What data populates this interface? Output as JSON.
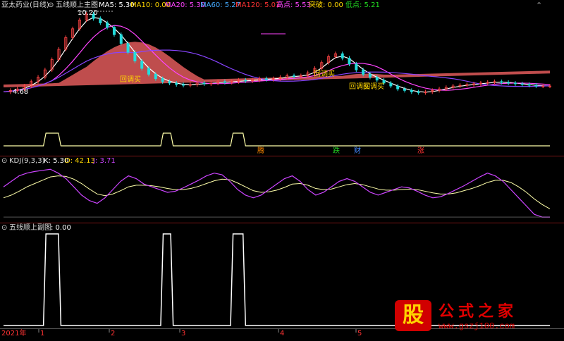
{
  "main_panel": {
    "stock": "亚太药业(日线)",
    "indicator": "五线顺上主图",
    "ma": [
      {
        "label": "MA5: 5.30",
        "color": "#ffffff"
      },
      {
        "label": "MA10: 0.00",
        "color": "#ffd700"
      },
      {
        "label": "MA20: 5.30",
        "color": "#ff44ff"
      },
      {
        "label": "MA60: 5.27",
        "color": "#44aaff"
      },
      {
        "label": "MA120: 5.01",
        "color": "#ff3333"
      }
    ],
    "high_point": "高点: 5.53",
    "breakout": "突破: 0.00",
    "low_point": "低点: 5.21",
    "price_max": "10.20",
    "price_min": "4.68",
    "signals": [
      {
        "text": "回调买"
      },
      {
        "text": "回调买"
      },
      {
        "text": "回调买"
      },
      {
        "text": "回调买"
      }
    ],
    "markers": [
      {
        "text": "腾",
        "color": "#ff8800"
      },
      {
        "text": "跌",
        "color": "#22cc22"
      },
      {
        "text": "财",
        "color": "#4488ff"
      },
      {
        "text": "涨",
        "color": "#ff3333"
      }
    ]
  },
  "kdj_panel": {
    "title": "KDJ(9,3,3)",
    "k": "K: 5.30",
    "d": "D: 42.13",
    "j": "J: 3.71"
  },
  "sub_panel": {
    "title": "五线顺上副图",
    "value": ": 0.00"
  },
  "time_axis": {
    "year": "2021年",
    "months": [
      "1",
      "2",
      "3",
      "4",
      "5"
    ]
  },
  "watermark": {
    "badge": "股",
    "title": "公式之家",
    "url": "www.gszj100.com"
  },
  "chart_data": {
    "type": "line",
    "title": "",
    "price_range": [
      4.68,
      10.2
    ],
    "kdj_range": [
      0,
      100
    ],
    "sub_range": [
      0,
      1
    ],
    "sub_signal": [
      0,
      0,
      0,
      0,
      0,
      0,
      0,
      0,
      0,
      0,
      0,
      0,
      0,
      0,
      0,
      0,
      0,
      1,
      1,
      1,
      1,
      1,
      1,
      0,
      0,
      0,
      0,
      0,
      0,
      0,
      0,
      0,
      0,
      0,
      0,
      0,
      0,
      0,
      0,
      0,
      0,
      0,
      0,
      0,
      0,
      0,
      0,
      0,
      0,
      0,
      0,
      0,
      0,
      0,
      0,
      0,
      0,
      0,
      0,
      0,
      0,
      0,
      0,
      0,
      1,
      1,
      1,
      1,
      0,
      0,
      0,
      0,
      0,
      0,
      0,
      0,
      0,
      0,
      0,
      0,
      0,
      0,
      0,
      0,
      0,
      0,
      0,
      0,
      0,
      0,
      0,
      0,
      1,
      1,
      1,
      1,
      1,
      0,
      0,
      0,
      0,
      0,
      0,
      0,
      0,
      0,
      0,
      0,
      0,
      0,
      0,
      0,
      0,
      0,
      0,
      0,
      0,
      0,
      0,
      0,
      0,
      0,
      0,
      0,
      0,
      0,
      0,
      0,
      0,
      0,
      0,
      0,
      0,
      0,
      0,
      0,
      0,
      0,
      0,
      0,
      0,
      0,
      0,
      0,
      0,
      0,
      0,
      0,
      0,
      0,
      0,
      0,
      0,
      0,
      0,
      0,
      0,
      0,
      0,
      0,
      0,
      0,
      0,
      0,
      0,
      0,
      0,
      0,
      0,
      0,
      0,
      0,
      0,
      0,
      0,
      0,
      0,
      0,
      0,
      0,
      0,
      0,
      0,
      0,
      0,
      0,
      0,
      0,
      0,
      0,
      0,
      0,
      0,
      0,
      0,
      0,
      0,
      0,
      0,
      0,
      0,
      0,
      0,
      0,
      0,
      0,
      0,
      0,
      0,
      0,
      0,
      0,
      0,
      0,
      0,
      0,
      0,
      0,
      0,
      0
    ],
    "price_close": [
      4.9,
      5.0,
      5.1,
      5.3,
      5.6,
      5.9,
      6.4,
      7.1,
      7.8,
      8.6,
      9.2,
      9.8,
      10.2,
      9.9,
      9.6,
      9.3,
      8.8,
      8.2,
      7.6,
      7.0,
      6.5,
      6.1,
      5.8,
      5.6,
      5.5,
      5.4,
      5.35,
      5.4,
      5.5,
      5.45,
      5.5,
      5.6,
      5.55,
      5.6,
      5.7,
      5.65,
      5.7,
      5.8,
      5.75,
      5.8,
      5.9,
      6.0,
      5.95,
      6.0,
      6.2,
      6.5,
      6.9,
      7.3,
      7.5,
      7.2,
      6.8,
      6.4,
      6.1,
      5.9,
      5.7,
      5.5,
      5.3,
      5.1,
      5.0,
      4.9,
      4.85,
      4.9,
      5.0,
      5.1,
      5.2,
      5.3,
      5.35,
      5.4,
      5.45,
      5.5,
      5.55,
      5.6,
      5.55,
      5.5,
      5.45,
      5.4,
      5.35,
      5.3,
      5.3,
      5.3
    ],
    "kdj_k": [
      60,
      70,
      80,
      85,
      88,
      90,
      92,
      85,
      75,
      60,
      45,
      35,
      30,
      40,
      55,
      70,
      80,
      75,
      65,
      60,
      55,
      50,
      52,
      58,
      65,
      72,
      80,
      85,
      82,
      70,
      55,
      45,
      40,
      45,
      55,
      65,
      75,
      80,
      70,
      55,
      45,
      50,
      60,
      70,
      75,
      70,
      60,
      50,
      45,
      50,
      55,
      60,
      58,
      52,
      45,
      40,
      42,
      48,
      55,
      62,
      70,
      78,
      85,
      80,
      70,
      55,
      40,
      25,
      10,
      5,
      5
    ],
    "kdj_d": [
      40,
      45,
      52,
      60,
      66,
      72,
      78,
      80,
      79,
      74,
      66,
      56,
      47,
      44,
      47,
      53,
      60,
      63,
      63,
      62,
      60,
      57,
      55,
      55,
      57,
      61,
      66,
      71,
      74,
      73,
      67,
      60,
      53,
      50,
      51,
      54,
      59,
      65,
      66,
      63,
      57,
      55,
      56,
      60,
      64,
      66,
      64,
      60,
      56,
      54,
      54,
      55,
      56,
      55,
      52,
      49,
      47,
      47,
      49,
      53,
      57,
      62,
      68,
      72,
      72,
      68,
      60,
      50,
      38,
      28,
      20
    ]
  }
}
